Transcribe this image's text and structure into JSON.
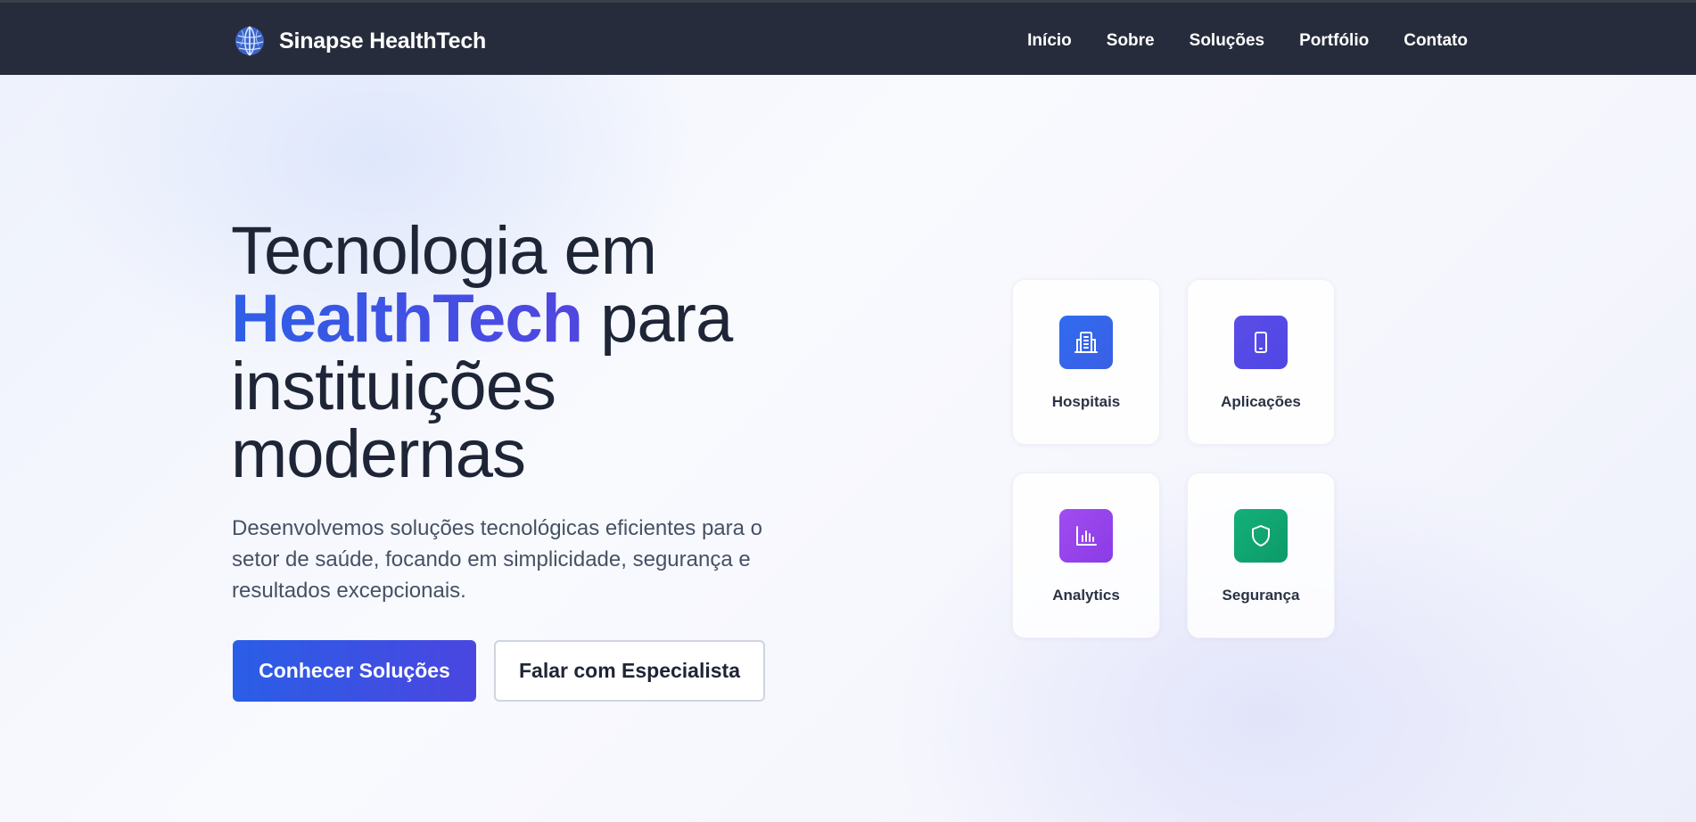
{
  "brand": {
    "name": "Sinapse HealthTech",
    "logo_icon": "brain-globe-icon"
  },
  "nav": {
    "items": [
      {
        "label": "Início"
      },
      {
        "label": "Sobre"
      },
      {
        "label": "Soluções"
      },
      {
        "label": "Portfólio"
      },
      {
        "label": "Contato"
      }
    ]
  },
  "hero": {
    "title_line1": "Tecnologia em",
    "title_highlight": "HealthTech",
    "title_after_highlight": " para",
    "title_line3": "instituições",
    "title_line4": "modernas",
    "description": "Desenvolvemos soluções tecnológicas eficientes para o setor de saúde, focando em simplicidade, segurança e resultados excepcionais.",
    "primary_button": "Conhecer Soluções",
    "secondary_button": "Falar com Especialista"
  },
  "cards": [
    {
      "label": "Hospitais",
      "icon": "hospital-building-icon",
      "color_from": "#2f6cf0",
      "color_to": "#3b5fe4"
    },
    {
      "label": "Aplicações",
      "icon": "smartphone-icon",
      "color_from": "#5b4de6",
      "color_to": "#4f46e5"
    },
    {
      "label": "Analytics",
      "icon": "bar-chart-icon",
      "color_from": "#a14cf0",
      "color_to": "#8b3be6"
    },
    {
      "label": "Segurança",
      "icon": "shield-icon",
      "color_from": "#14b07a",
      "color_to": "#0d9a68"
    }
  ],
  "colors": {
    "navbar_bg": "#262c3b",
    "accent_blue": "#2a5ee6",
    "accent_indigo": "#4a46e0"
  }
}
